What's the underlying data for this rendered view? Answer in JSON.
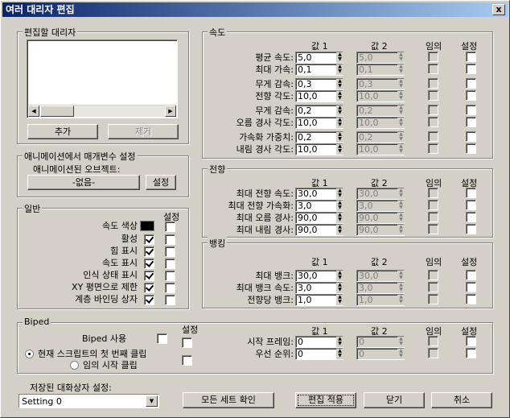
{
  "window": {
    "title": "여러 대리자 편집",
    "close": "x"
  },
  "edit": {
    "title": "편집할 대리자",
    "add": "추가",
    "remove": "제거"
  },
  "anim": {
    "title": "애니메이션에서 매개변수 설정",
    "objects_label": "애니메이션된 오브젝트:",
    "none": "-없음-",
    "set": "설정"
  },
  "general": {
    "title": "일반",
    "set_header": "설정",
    "rows": [
      {
        "label": "속도 색상"
      },
      {
        "label": "활성"
      },
      {
        "label": "힘 표시"
      },
      {
        "label": "속도 표시"
      },
      {
        "label": "인식 상태 표시"
      },
      {
        "label": "XY 평면으로 제한"
      },
      {
        "label": "계층 바인딩 상자"
      }
    ]
  },
  "speed": {
    "title": "속도",
    "headers": {
      "v1": "값 1",
      "v2": "값 2",
      "random": "임의",
      "set": "설정"
    },
    "rows": [
      {
        "label": "평균 속도:",
        "v1": "5,0",
        "v2": "5,0"
      },
      {
        "label": "최대 가속:",
        "v1": "0,1",
        "v2": "0,1"
      },
      {
        "label": "무게 감속:",
        "v1": "0,3",
        "v2": "0,3"
      },
      {
        "label": "전향 각도:",
        "v1": "10,0",
        "v2": "10,0"
      },
      {
        "label": "무게 감속:",
        "v1": "0,2",
        "v2": "0,2"
      },
      {
        "label": "오름 경사 각도:",
        "v1": "10,0",
        "v2": "10,0"
      },
      {
        "label": "가속화 가중치:",
        "v1": "0,2",
        "v2": "0,2"
      },
      {
        "label": "내림 경사 각도:",
        "v1": "10,0",
        "v2": "10,0"
      }
    ]
  },
  "turn": {
    "title": "전향",
    "headers": {
      "v1": "값 1",
      "v2": "값 2",
      "random": "임의",
      "set": "설정"
    },
    "rows": [
      {
        "label": "최대 전향 속도:",
        "v1": "30,0",
        "v2": "30,0"
      },
      {
        "label": "최대 전향 가속화:",
        "v1": "3,0",
        "v2": "3,0"
      },
      {
        "label": "최대 오름 경사:",
        "v1": "90,0",
        "v2": "90,0"
      },
      {
        "label": "최대 내림 경사:",
        "v1": "90,0",
        "v2": "90,0"
      }
    ]
  },
  "bank": {
    "title": "뱅킹",
    "headers": {
      "v1": "값 1",
      "v2": "값 2",
      "random": "임의",
      "set": "설정"
    },
    "rows": [
      {
        "label": "최대 뱅크:",
        "v1": "30,0",
        "v2": "30,0"
      },
      {
        "label": "최대 뱅크 속도:",
        "v1": "3,0",
        "v2": "3,0"
      },
      {
        "label": "전향당 뱅크:",
        "v1": "1,0",
        "v2": "1,0"
      }
    ]
  },
  "biped": {
    "title": "Biped",
    "use": "Biped 사용",
    "set_header": "설정",
    "radio1": "현재 스크립트의 첫 번째 클립",
    "radio2": "임의 시작 클립",
    "headers": {
      "v1": "값 1",
      "v2": "값 2",
      "random": "임의",
      "set": "설정"
    },
    "rows": [
      {
        "label": "시작 프레임:",
        "v1": "0",
        "v2": "0"
      },
      {
        "label": "우선 순위:",
        "v1": "0",
        "v2": "0"
      }
    ]
  },
  "footer": {
    "saved_label": "저장된 대화상자 설정:",
    "setting": "Setting 0",
    "check_all": "모든 세트 확인",
    "apply": "편집 적용",
    "close": "닫기",
    "cancel": "취소"
  }
}
